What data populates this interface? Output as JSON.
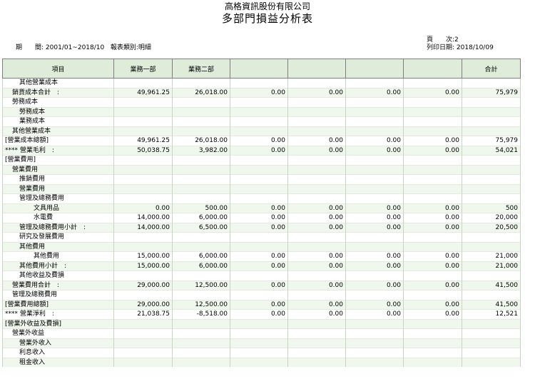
{
  "header": {
    "company": "高格資訊股份有限公司",
    "title": "多部門損益分析表",
    "period_label": "期　　間:",
    "period_value": "2001/01~2018/10",
    "type_label": "報表類別:",
    "type_value": "明細",
    "page_label": "頁　　次:",
    "page_value": "2",
    "print_date_label": "列印日期:",
    "print_date_value": "2018/10/09"
  },
  "columns": [
    "項目",
    "業務一部",
    "業務二部",
    "",
    "",
    "",
    "",
    "合計"
  ],
  "rows": [
    {
      "indent": 2,
      "label": "其他營業成本",
      "values": [
        "",
        "",
        "",
        "",
        "",
        "",
        ""
      ]
    },
    {
      "indent": 1,
      "label": "銷貨成本合計　:",
      "values": [
        "49,961.25",
        "26,018.00",
        "0.00",
        "0.00",
        "0.00",
        "0.00",
        "75,979"
      ]
    },
    {
      "indent": 1,
      "label": "勞務成本",
      "values": [
        "",
        "",
        "",
        "",
        "",
        "",
        ""
      ]
    },
    {
      "indent": 2,
      "label": "勞務成本",
      "values": [
        "",
        "",
        "",
        "",
        "",
        "",
        ""
      ]
    },
    {
      "indent": 2,
      "label": "業務成本",
      "values": [
        "",
        "",
        "",
        "",
        "",
        "",
        ""
      ]
    },
    {
      "indent": 1,
      "label": "其他營業成本",
      "values": [
        "",
        "",
        "",
        "",
        "",
        "",
        ""
      ]
    },
    {
      "indent": 0,
      "label": "[營業成本總額]",
      "values": [
        "49,961.25",
        "26,018.00",
        "0.00",
        "0.00",
        "0.00",
        "0.00",
        "75,979"
      ]
    },
    {
      "indent": 0,
      "label": "**** 營業毛利　:",
      "values": [
        "50,038.75",
        "3,982.00",
        "0.00",
        "0.00",
        "0.00",
        "0.00",
        "54,021"
      ]
    },
    {
      "indent": 0,
      "label": "[營業費用]",
      "values": [
        "",
        "",
        "",
        "",
        "",
        "",
        ""
      ]
    },
    {
      "indent": 1,
      "label": "營業費用",
      "values": [
        "",
        "",
        "",
        "",
        "",
        "",
        ""
      ]
    },
    {
      "indent": 2,
      "label": "推銷費用",
      "values": [
        "",
        "",
        "",
        "",
        "",
        "",
        ""
      ]
    },
    {
      "indent": 2,
      "label": "營業費用",
      "values": [
        "",
        "",
        "",
        "",
        "",
        "",
        ""
      ]
    },
    {
      "indent": 2,
      "label": "管理及總務費用",
      "values": [
        "",
        "",
        "",
        "",
        "",
        "",
        ""
      ]
    },
    {
      "indent": 4,
      "label": "文具用品",
      "values": [
        "0.00",
        "500.00",
        "0.00",
        "0.00",
        "0.00",
        "0.00",
        "500"
      ]
    },
    {
      "indent": 4,
      "label": "水電費",
      "values": [
        "14,000.00",
        "6,000.00",
        "0.00",
        "0.00",
        "0.00",
        "0.00",
        "20,000"
      ]
    },
    {
      "indent": 2,
      "label": "管理及總務費用小計　:",
      "values": [
        "14,000.00",
        "6,500.00",
        "0.00",
        "0.00",
        "0.00",
        "0.00",
        "20,500"
      ]
    },
    {
      "indent": 2,
      "label": "研究及發展費用",
      "values": [
        "",
        "",
        "",
        "",
        "",
        "",
        ""
      ]
    },
    {
      "indent": 2,
      "label": "其他費用",
      "values": [
        "",
        "",
        "",
        "",
        "",
        "",
        ""
      ]
    },
    {
      "indent": 4,
      "label": "其他費用",
      "values": [
        "15,000.00",
        "6,000.00",
        "0.00",
        "0.00",
        "0.00",
        "0.00",
        "21,000"
      ]
    },
    {
      "indent": 2,
      "label": "其他費用小計　:",
      "values": [
        "15,000.00",
        "6,000.00",
        "0.00",
        "0.00",
        "0.00",
        "0.00",
        "21,000"
      ]
    },
    {
      "indent": 2,
      "label": "其他收益及費損",
      "values": [
        "",
        "",
        "",
        "",
        "",
        "",
        ""
      ]
    },
    {
      "indent": 1,
      "label": "營業費用合計　:",
      "values": [
        "29,000.00",
        "12,500.00",
        "0.00",
        "0.00",
        "0.00",
        "0.00",
        "41,500"
      ]
    },
    {
      "indent": 1,
      "label": "管理及總務費用",
      "values": [
        "",
        "",
        "",
        "",
        "",
        "",
        ""
      ]
    },
    {
      "indent": 0,
      "label": "[營業費用總額]",
      "values": [
        "29,000.00",
        "12,500.00",
        "0.00",
        "0.00",
        "0.00",
        "0.00",
        "41,500"
      ]
    },
    {
      "indent": 0,
      "label": "**** 營業淨利　:",
      "values": [
        "21,038.75",
        "-8,518.00",
        "0.00",
        "0.00",
        "0.00",
        "0.00",
        "12,521"
      ]
    },
    {
      "indent": 0,
      "label": "[營業外收益及費損]",
      "values": [
        "",
        "",
        "",
        "",
        "",
        "",
        ""
      ]
    },
    {
      "indent": 1,
      "label": "營業外收益",
      "values": [
        "",
        "",
        "",
        "",
        "",
        "",
        ""
      ]
    },
    {
      "indent": 2,
      "label": "營業外收入",
      "values": [
        "",
        "",
        "",
        "",
        "",
        "",
        ""
      ]
    },
    {
      "indent": 2,
      "label": "利息收入",
      "values": [
        "",
        "",
        "",
        "",
        "",
        "",
        ""
      ]
    },
    {
      "indent": 2,
      "label": "租金收入",
      "values": [
        "",
        "",
        "",
        "",
        "",
        "",
        ""
      ]
    }
  ]
}
